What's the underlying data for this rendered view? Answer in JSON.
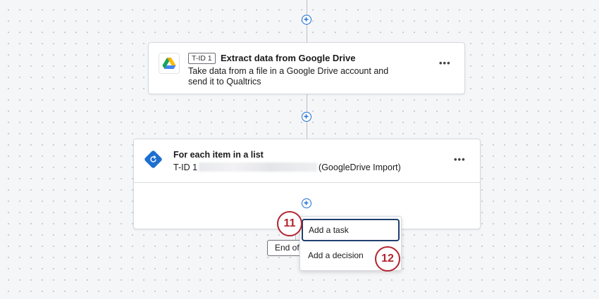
{
  "task_card": {
    "tid_label": "T-ID 1",
    "title": "Extract data from Google Drive",
    "description": "Take data from a file in a Google Drive account and send it to Qualtrics",
    "more_label": "•••"
  },
  "loop_card": {
    "title": "For each item in a list",
    "subtitle_prefix": "T-ID 1",
    "subtitle_suffix": "(GoogleDrive Import)",
    "more_label": "•••"
  },
  "end_button": {
    "label": "End of"
  },
  "add_menu": {
    "items": [
      {
        "label": "Add a task"
      },
      {
        "label": "Add a decision"
      }
    ]
  },
  "callouts": [
    "11",
    "12"
  ],
  "colors": {
    "accent": "#1d6fd1",
    "callout": "#b3232f"
  }
}
